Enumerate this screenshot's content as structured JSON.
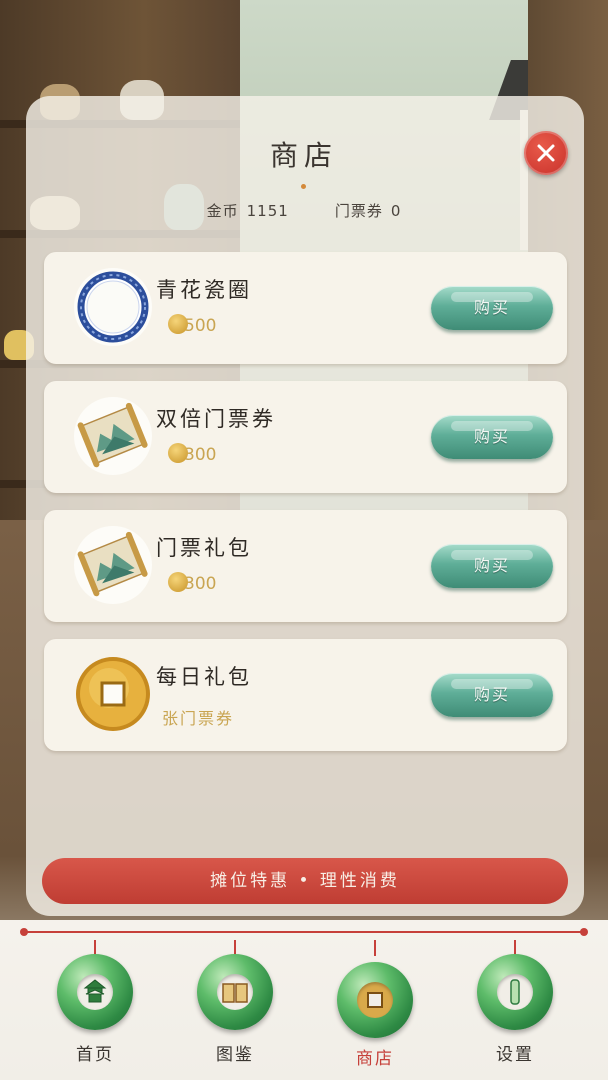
{
  "header": {
    "title": "商店",
    "gold_label": "金币",
    "gold_value": "1151",
    "ticket_label": "门票券",
    "ticket_value": "0"
  },
  "items": [
    {
      "name": "青花瓷圈",
      "price": "500",
      "buy_label": "购买",
      "icon": "blue-porcelain-ring-icon"
    },
    {
      "name": "双倍门票券",
      "price": "300",
      "buy_label": "购买",
      "icon": "scroll-painting-icon"
    },
    {
      "name": "门票礼包",
      "price": "300",
      "buy_label": "购买",
      "icon": "scroll-painting-icon"
    },
    {
      "name": "每日礼包",
      "subtext": "张门票券",
      "buy_label": "购买",
      "icon": "gold-coin-icon"
    }
  ],
  "banner": {
    "text": "摊位特惠 • 理性消费"
  },
  "nav": {
    "items": [
      {
        "label": "首页",
        "icon": "pagoda-jade-icon",
        "active": false
      },
      {
        "label": "图鉴",
        "icon": "book-jade-icon",
        "active": false
      },
      {
        "label": "商店",
        "icon": "coin-jade-icon",
        "active": true
      },
      {
        "label": "设置",
        "icon": "gear-jade-icon",
        "active": false
      }
    ]
  },
  "colors": {
    "accent_red": "#c6403a",
    "buy_green": "#5fae98",
    "gold": "#c9a552"
  }
}
